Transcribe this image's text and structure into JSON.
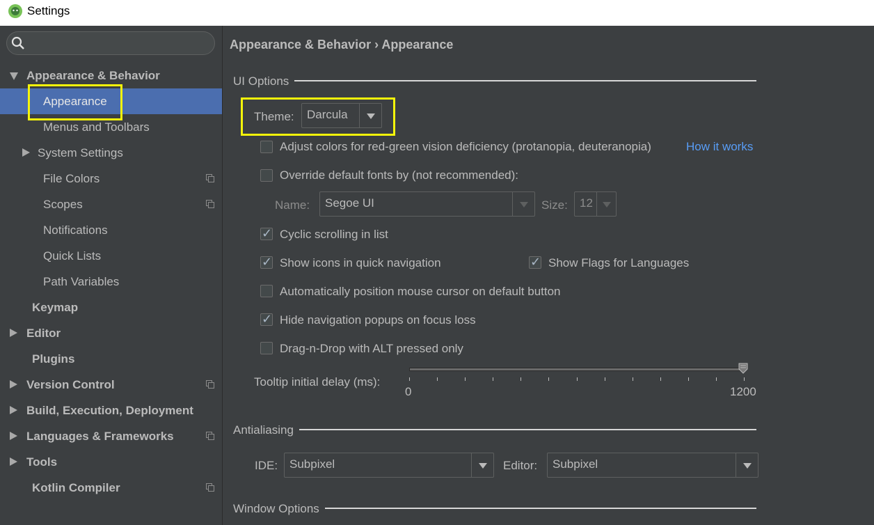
{
  "window": {
    "title": "Settings"
  },
  "sidebar": {
    "search_placeholder": "",
    "items": [
      {
        "label": "Appearance & Behavior"
      },
      {
        "label": "Appearance"
      },
      {
        "label": "Menus and Toolbars"
      },
      {
        "label": "System Settings"
      },
      {
        "label": "File Colors"
      },
      {
        "label": "Scopes"
      },
      {
        "label": "Notifications"
      },
      {
        "label": "Quick Lists"
      },
      {
        "label": "Path Variables"
      },
      {
        "label": "Keymap"
      },
      {
        "label": "Editor"
      },
      {
        "label": "Plugins"
      },
      {
        "label": "Version Control"
      },
      {
        "label": "Build, Execution, Deployment"
      },
      {
        "label": "Languages & Frameworks"
      },
      {
        "label": "Tools"
      },
      {
        "label": "Kotlin Compiler"
      }
    ]
  },
  "breadcrumb": "Appearance & Behavior › Appearance",
  "ui_options": {
    "title": "UI Options",
    "theme_label": "Theme:",
    "theme_value": "Darcula",
    "adjust_colors": {
      "label": "Adjust colors for red-green vision deficiency (protanopia, deuteranopia)",
      "checked": false
    },
    "how_it_works": "How it works",
    "override_fonts": {
      "label": "Override default fonts by (not recommended):",
      "checked": false
    },
    "font_name_label": "Name:",
    "font_name_value": "Segoe UI",
    "font_size_label": "Size:",
    "font_size_value": "12",
    "cyclic_scrolling": {
      "label": "Cyclic scrolling in list",
      "checked": true
    },
    "show_icons": {
      "label": "Show icons in quick navigation",
      "checked": true
    },
    "show_flags": {
      "label": "Show Flags for Languages",
      "checked": true
    },
    "auto_position": {
      "label": "Automatically position mouse cursor on default button",
      "checked": false
    },
    "hide_popups": {
      "label": "Hide navigation popups on focus loss",
      "checked": true
    },
    "drag_n_drop": {
      "label": "Drag-n-Drop with ALT pressed only",
      "checked": false
    },
    "tooltip_label": "Tooltip initial delay (ms):",
    "tooltip_min": "0",
    "tooltip_max": "1200",
    "tooltip_value": 1200
  },
  "antialiasing": {
    "title": "Antialiasing",
    "ide_label": "IDE:",
    "ide_value": "Subpixel",
    "editor_label": "Editor:",
    "editor_value": "Subpixel"
  },
  "window_options": {
    "title": "Window Options"
  },
  "colors": {
    "selection": "#4b6eaf",
    "highlight": "#f5f50a",
    "link": "#589df6",
    "background": "#3c3f41"
  }
}
